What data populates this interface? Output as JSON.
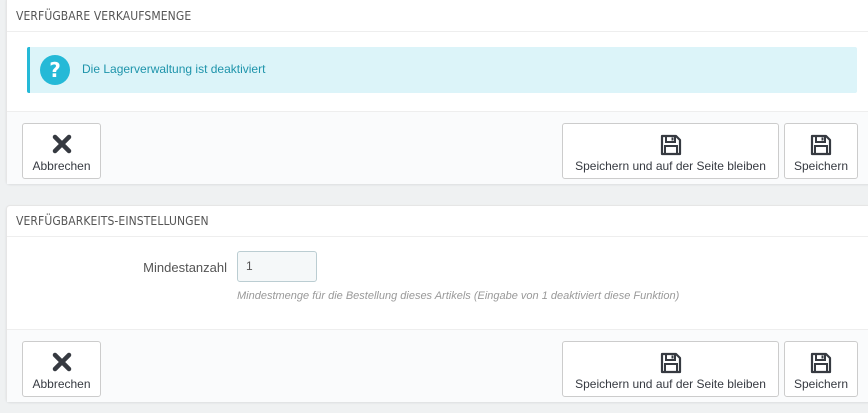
{
  "stock_panel": {
    "heading": "VERFÜGBARE VERKAUFSMENGE",
    "alert_icon": "question-circle-icon",
    "alert_glyph": "?",
    "alert_text": "Die Lagerverwaltung ist deaktiviert",
    "accent_color": "#25b9d7"
  },
  "availability_panel": {
    "heading": "VERFÜGBARKEITS-EINSTELLUNGEN",
    "min_qty_label": "Mindestanzahl",
    "min_qty_value": "1",
    "min_qty_help": "Mindestmenge für die Bestellung dieses Artikels (Eingabe von 1 deaktiviert diese Funktion)"
  },
  "footer": {
    "cancel_label": "Abbrechen",
    "cancel_icon": "close-icon",
    "save_stay_label": "Speichern und auf der Seite bleiben",
    "save_label": "Speichern",
    "save_icon": "floppy-disk-icon"
  }
}
